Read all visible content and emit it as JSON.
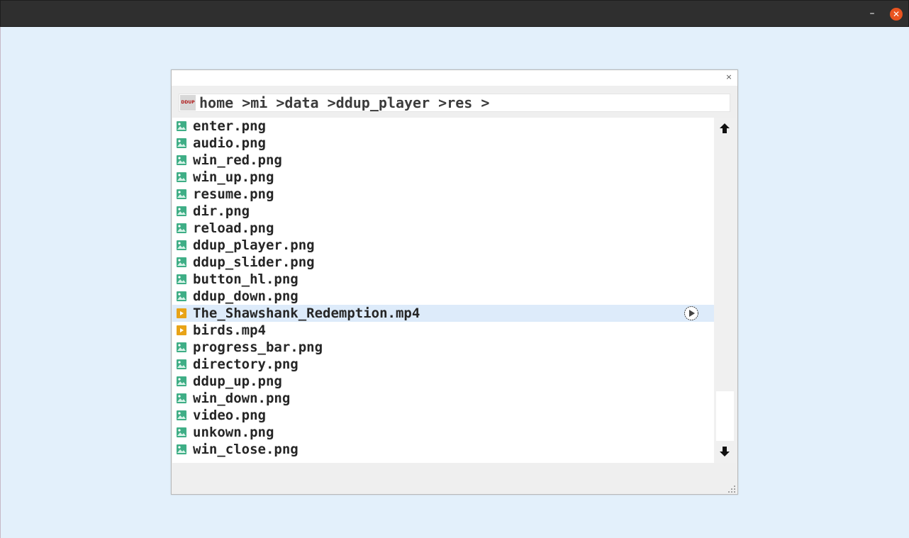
{
  "window": {
    "minimize_label": "–",
    "close_label": "✕",
    "close_color": "#e95420"
  },
  "dialog": {
    "close_label": "×",
    "path": "home >mi >data >ddup_player >res >",
    "logo_text": "DDUP"
  },
  "files": [
    {
      "name": "enter.png",
      "type": "image"
    },
    {
      "name": "audio.png",
      "type": "image"
    },
    {
      "name": "win_red.png",
      "type": "image"
    },
    {
      "name": "win_up.png",
      "type": "image"
    },
    {
      "name": "resume.png",
      "type": "image"
    },
    {
      "name": "dir.png",
      "type": "image"
    },
    {
      "name": "reload.png",
      "type": "image"
    },
    {
      "name": "ddup_player.png",
      "type": "image"
    },
    {
      "name": "ddup_slider.png",
      "type": "image"
    },
    {
      "name": "button_hl.png",
      "type": "image"
    },
    {
      "name": "ddup_down.png",
      "type": "image"
    },
    {
      "name": "The_Shawshank_Redemption.mp4",
      "type": "video",
      "selected": true
    },
    {
      "name": "birds.mp4",
      "type": "video"
    },
    {
      "name": "progress_bar.png",
      "type": "image"
    },
    {
      "name": "directory.png",
      "type": "image"
    },
    {
      "name": "ddup_up.png",
      "type": "image"
    },
    {
      "name": "win_down.png",
      "type": "image"
    },
    {
      "name": "video.png",
      "type": "image"
    },
    {
      "name": "unkown.png",
      "type": "image"
    },
    {
      "name": "win_close.png",
      "type": "image"
    }
  ],
  "scrollbar": {
    "up_icon": "arrow-up-icon",
    "down_icon": "arrow-down-icon",
    "position": 0.85
  },
  "colors": {
    "background": "#e3f0fb",
    "selected_row": "#ddebfa",
    "image_icon": "#3fae86",
    "video_icon": "#e8a317"
  }
}
